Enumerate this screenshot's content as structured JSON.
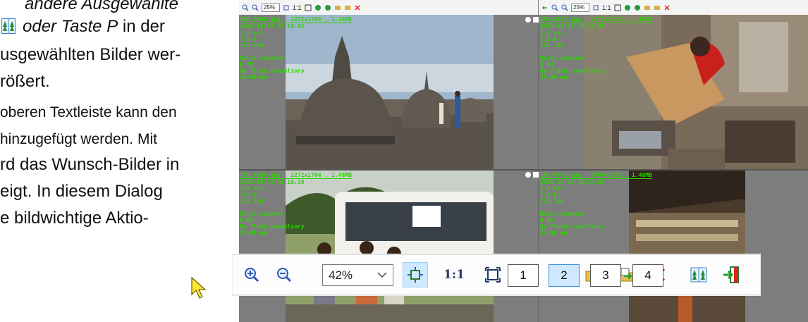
{
  "document": {
    "line1": "andere Ausgewählte",
    "line2_italic": "oder Taste P",
    "line2_rest": " in der",
    "line3": "usgewählten Bilder wer-",
    "line4": "rößert.",
    "line5": "oberen Textleiste kann den",
    "line6": " hinzugefügt werden. Mit",
    "line7": "rd das Wunsch-Bilder in",
    "line8": "eigt. In diesem Dialog",
    "line9": "e bildwichtige  Aktio-",
    "icon": "compare-icon"
  },
  "viewer": {
    "left_zoom": "25%",
    "right_zoom": "25%",
    "panes": [
      {
        "filename": "IMG_0886.jpg , 2272x1704 , 1.43MB",
        "exif": "2005-10-18 10:16:02\n1/6 sec\nf/5.6\nISO 100\n\nMulti-segment\n0 EV\nNo flash,compulsory\n35.00 mm"
      },
      {
        "filename": "IMG_0887.jpg , 2272x1704 , 1.48MB",
        "exif": "2005-10-18 10:16:26\n1/5 sec\nf/5.6\nISO 100\n\nMulti-segment\n0 EV\nNo flash,compulsory\n35.00 mm"
      },
      {
        "filename": "IMG_0888.jpg , 2272x1704 , 1.46MB",
        "exif": "2005-10-18 10:18:39\n1/4 sec\nf/5.6\nISO 100\n\nMulti-segment\n0 EV\nNo flash,compulsory\n35.00 mm"
      },
      {
        "filename": "IMG_0971.jpg , 1704x2272 , 1.48MB",
        "exif": "2005-10-19 10:52:03\n1/4 sec\nf/5.6\nISO 100\n\nMulti-segment\n0 EV\nNo flash,compulsory\n35.00 mm"
      }
    ]
  },
  "toolbar": {
    "zoom_value": "42%",
    "one_to_one_label": "1:1",
    "layout_buttons": [
      "1",
      "2",
      "3",
      "4"
    ],
    "active_layout": "2",
    "icons": {
      "zoom_in": "zoom-in-icon",
      "zoom_out": "zoom-out-icon",
      "fit": "fit-to-window-icon",
      "full": "fullscreen-icon",
      "rotate_left": "rotate-left-icon",
      "rotate_right": "rotate-right-icon",
      "copy_to": "copy-to-icon",
      "move_to": "move-to-icon",
      "delete": "delete-icon",
      "compare": "compare-icon",
      "exit": "exit-icon"
    },
    "colors": {
      "active_bg": "#cde8ff",
      "delete": "#e0231b",
      "green": "#1e9e2a"
    }
  }
}
